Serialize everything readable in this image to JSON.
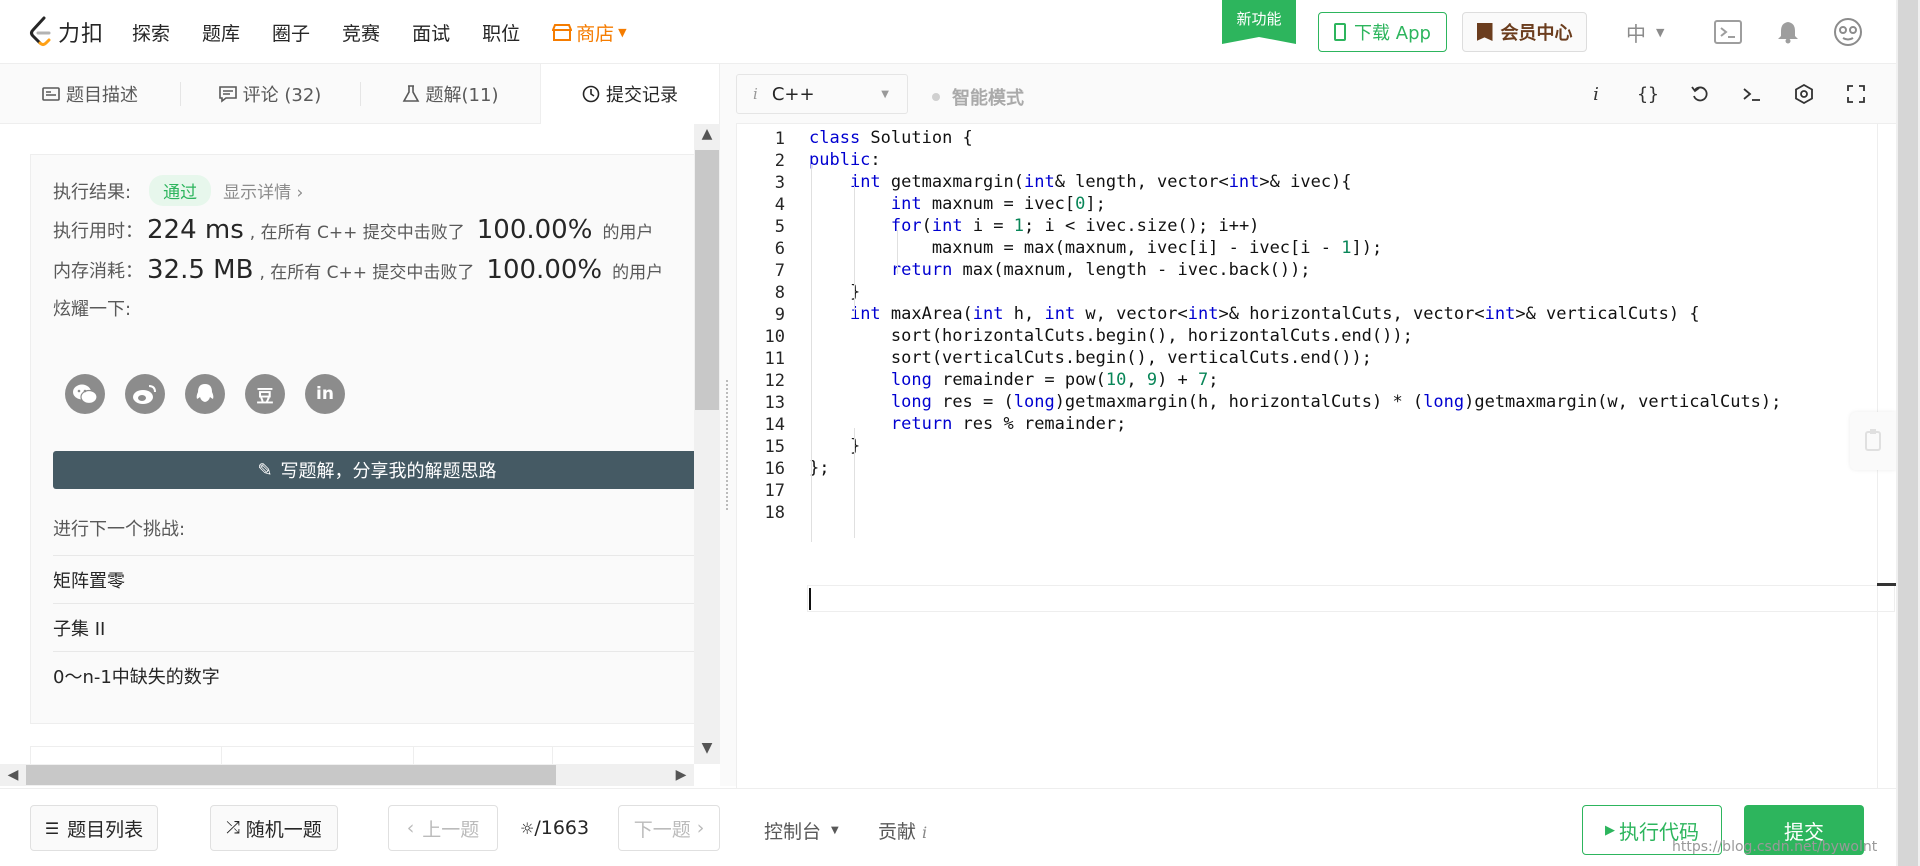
{
  "nav": {
    "logo_text": "力扣",
    "items": [
      "探索",
      "题库",
      "圈子",
      "竞赛",
      "面试",
      "职位"
    ],
    "store_label": "商店",
    "new_feature": "新功能",
    "download_app": "下载 App",
    "vip_center": "会员中心",
    "language": "中"
  },
  "tabs": [
    {
      "label": "题目描述"
    },
    {
      "label": "评论 (32)"
    },
    {
      "label": "题解(11)"
    },
    {
      "label": "提交记录"
    }
  ],
  "result": {
    "status_label": "执行结果:",
    "status_value": "通过",
    "details_link": "显示详情 ›",
    "time_label": "执行用时：",
    "time_value": "224 ms",
    "time_text": ", 在所有 C++ 提交中击败了",
    "time_percent": "100.00%",
    "time_suffix": "的用户",
    "mem_label": "内存消耗：",
    "mem_value": "32.5 MB",
    "mem_text": ", 在所有 C++ 提交中击败了",
    "mem_percent": "100.00%",
    "mem_suffix": "的用户",
    "share_label": "炫耀一下:",
    "social": [
      "wechat",
      "weibo",
      "qq",
      "douban",
      "linkedin"
    ],
    "social_glyphs": {
      "douban": "豆",
      "linkedin": "in"
    },
    "write_solution": "写题解，分享我的解题思路",
    "next_label": "进行下一个挑战:",
    "next_items": [
      "矩阵置零",
      "子集 II",
      "0～n-1中缺失的数字"
    ]
  },
  "editor": {
    "language": "C++",
    "smart_mode": "智能模式",
    "code_lines": [
      "<span class=\"kw\">class</span> Solution {",
      "<span class=\"kw\">public</span>:",
      "    <span class=\"kw\">int</span> getmaxmargin(<span class=\"kw\">int</span>&amp; length, vector&lt;<span class=\"kw\">int</span>&gt;&amp; ivec){",
      "        <span class=\"kw\">int</span> maxnum = ivec[<span class=\"num\">0</span>];",
      "        <span class=\"kw\">for</span>(<span class=\"kw\">int</span> i = <span class=\"num\">1</span>; i &lt; ivec.size(); i++)",
      "            maxnum = max(maxnum, ivec[i] - ivec[i - <span class=\"num\">1</span>]);",
      "        <span class=\"kw\">return</span> max(maxnum, length - ivec.back());",
      "    }",
      "    <span class=\"kw\">int</span> maxArea(<span class=\"kw\">int</span> h, <span class=\"kw\">int</span> w, vector&lt;<span class=\"kw\">int</span>&gt;&amp; horizontalCuts, vector&lt;<span class=\"kw\">int</span>&gt;&amp; verticalCuts) {",
      "        sort(horizontalCuts.begin(), horizontalCuts.end());",
      "        sort(verticalCuts.begin(), verticalCuts.end());",
      "        <span class=\"kw\">long</span> remainder = pow(<span class=\"num\">10</span>, <span class=\"num\">9</span>) + <span class=\"num\">7</span>;",
      "        <span class=\"kw\">long</span> res = (<span class=\"kw\">long</span>)getmaxmargin(h, horizontalCuts) * (<span class=\"kw\">long</span>)getmaxmargin(w, verticalCuts);",
      "        <span class=\"kw\">return</span> res % remainder;",
      "    }",
      "};",
      "",
      ""
    ]
  },
  "bottom": {
    "problem_list": "题目列表",
    "random": "随机一题",
    "prev": "上一题",
    "pager": "/1663",
    "next": "下一题",
    "console": "控制台",
    "contribute": "贡献",
    "run": "执行代码",
    "submit": "提交",
    "watermark": "https://blog.csdn.net/bywolnt"
  },
  "colors": {
    "accent": "#2db55d",
    "store": "#f57c00",
    "keyword": "#0000d0",
    "number": "#098658",
    "write_button": "#455a64"
  }
}
